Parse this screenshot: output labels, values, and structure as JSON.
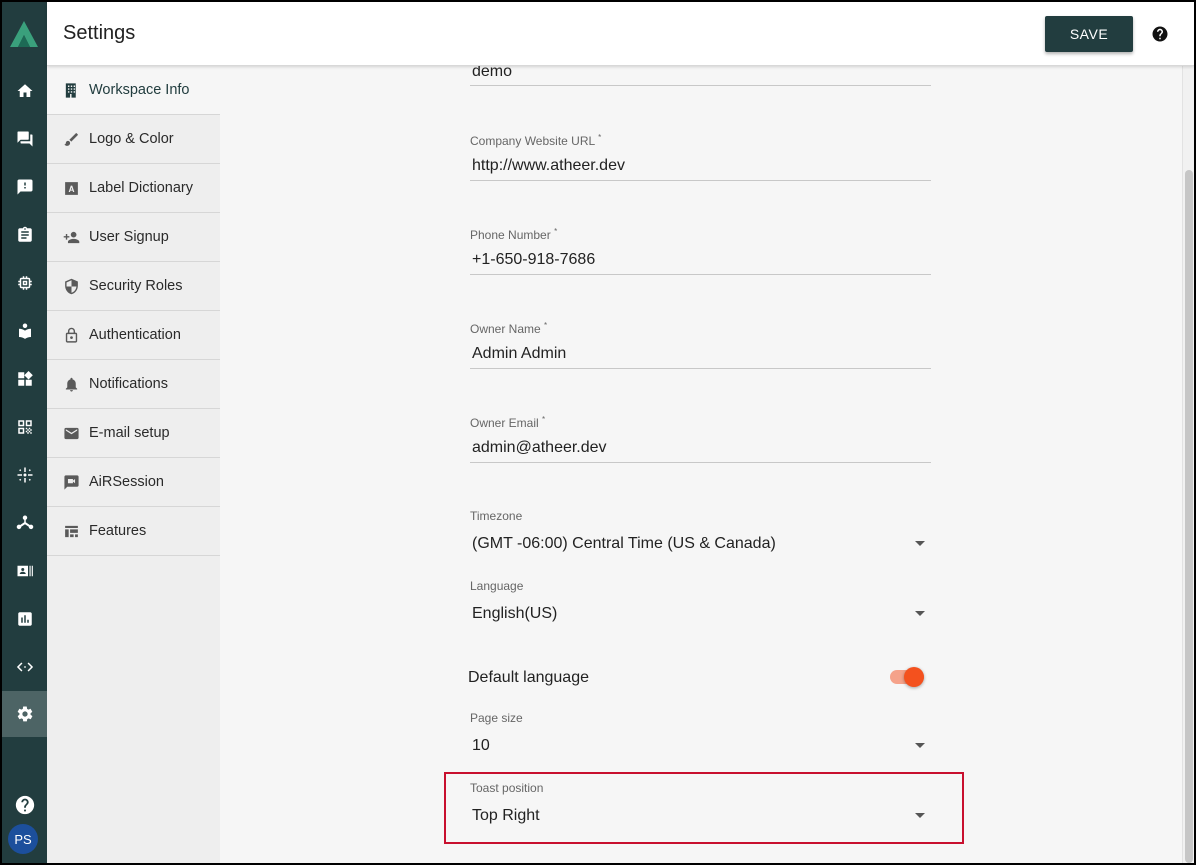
{
  "header": {
    "title": "Settings",
    "save_label": "SAVE"
  },
  "rail": {
    "items": [
      "home-icon",
      "chat-icon",
      "feedback-icon",
      "clipboard-icon",
      "memory-icon",
      "book-icon",
      "dashboard-icon",
      "qr-code-icon",
      "hub-icon",
      "share-icon",
      "badge-icon",
      "chart-icon",
      "code-icon",
      "gear-icon"
    ],
    "active": "gear-icon",
    "avatar_initials": "PS"
  },
  "nav": {
    "items": [
      {
        "label": "Workspace Info",
        "icon": "building-icon"
      },
      {
        "label": "Logo & Color",
        "icon": "brush-icon"
      },
      {
        "label": "Label Dictionary",
        "icon": "font-icon"
      },
      {
        "label": "User Signup",
        "icon": "person-add-icon"
      },
      {
        "label": "Security Roles",
        "icon": "shield-icon"
      },
      {
        "label": "Authentication",
        "icon": "lock-icon"
      },
      {
        "label": "Notifications",
        "icon": "bell-icon"
      },
      {
        "label": "E-mail setup",
        "icon": "mail-icon"
      },
      {
        "label": "AiRSession",
        "icon": "video-chat-icon"
      },
      {
        "label": "Features",
        "icon": "features-icon"
      }
    ]
  },
  "form": {
    "workspace": {
      "value": "demo"
    },
    "website": {
      "label": "Company Website URL",
      "required": "*",
      "value": "http://www.atheer.dev"
    },
    "phone": {
      "label": "Phone Number",
      "required": "*",
      "value": "+1-650-918-7686"
    },
    "owner_name": {
      "label": "Owner Name",
      "required": "*",
      "value": "Admin Admin"
    },
    "owner_email": {
      "label": "Owner Email",
      "required": "*",
      "value": "admin@atheer.dev"
    },
    "timezone": {
      "label": "Timezone",
      "value": "(GMT -06:00) Central Time (US & Canada)"
    },
    "language": {
      "label": "Language",
      "value": "English(US)"
    },
    "default_language": {
      "label": "Default language",
      "on": true
    },
    "page_size": {
      "label": "Page size",
      "value": "10"
    },
    "toast_position": {
      "label": "Toast position",
      "value": "Top Right"
    }
  },
  "colors": {
    "primary": "#223d3f",
    "accent": "#f4511e",
    "highlight": "#c8102e"
  }
}
